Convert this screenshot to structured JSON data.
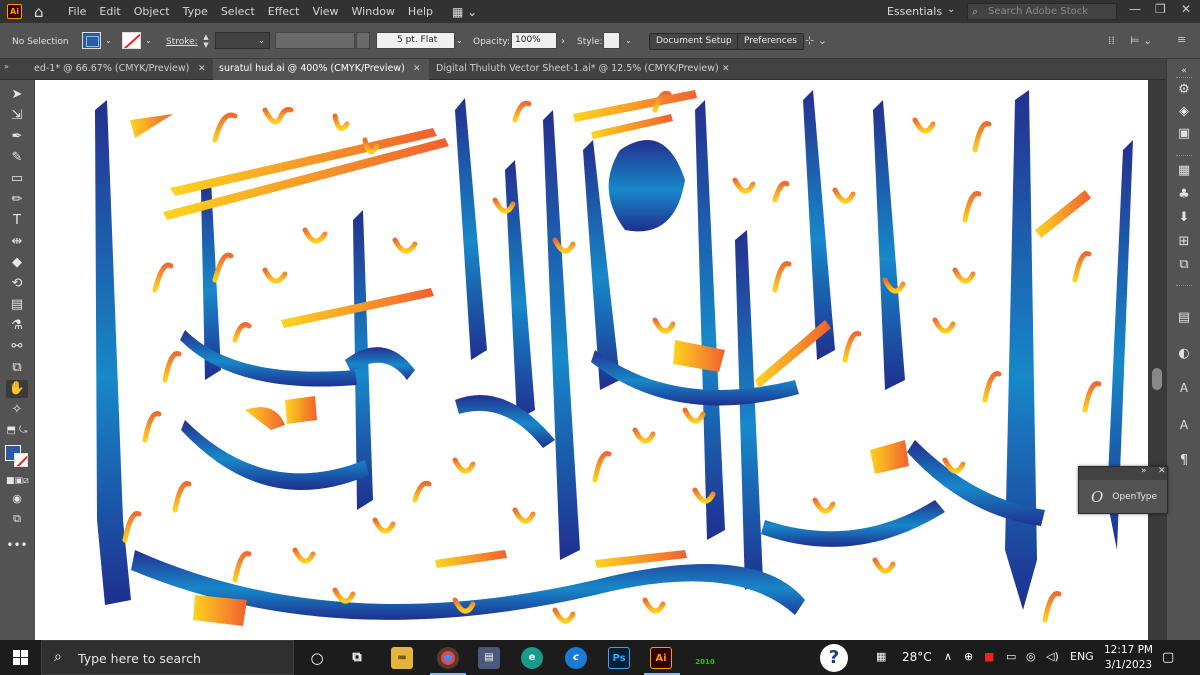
{
  "menubar": {
    "app_icon": "Ai",
    "items": [
      "File",
      "Edit",
      "Object",
      "Type",
      "Select",
      "Effect",
      "View",
      "Window",
      "Help"
    ],
    "workspace": "Essentials",
    "search_placeholder": "Search Adobe Stock"
  },
  "control_bar": {
    "selection": "No Selection",
    "stroke_label": "Stroke:",
    "brush": "5 pt. Flat",
    "opacity_label": "Opacity:",
    "opacity_value": "100%",
    "style_label": "Style:",
    "document_setup": "Document Setup",
    "preferences": "Preferences"
  },
  "tabs": [
    {
      "label": "ed-1* @ 66.67% (CMYK/Preview)",
      "active": false
    },
    {
      "label": "suratul hud.ai @ 400% (CMYK/Preview)",
      "active": true
    },
    {
      "label": "Digital Thuluth Vector Sheet-1.ai* @ 12.5% (CMYK/Preview)",
      "active": false
    }
  ],
  "tools": [
    "selection-tool-icon",
    "direct-selection-tool-icon",
    "pen-tool-icon",
    "curvature-tool-icon",
    "rectangle-tool-icon",
    "pencil-tool-icon",
    "type-tool-icon",
    "reflect-tool-icon",
    "eraser-tool-icon",
    "lasso-tool-icon",
    "gradient-tool-icon",
    "eyedropper-tool-icon",
    "blend-tool-icon",
    "artboard-tool-icon",
    "hand-tool-icon",
    "magic-wand-tool-icon"
  ],
  "colors": {
    "fill": "#2a5aa8",
    "calligraphy_dark": "#1f2f8f",
    "calligraphy_mid": "#1a8fd0",
    "ornament_warm": "#f07030",
    "ornament_yellow": "#ffd21e"
  },
  "opentype_panel": {
    "label": "OpenType"
  },
  "taskbar": {
    "search_placeholder": "Type here to search",
    "temperature": "28°C",
    "language": "ENG",
    "time": "12:17 PM",
    "date": "3/1/2023",
    "year_badge": "2010",
    "ps_label": "Ps",
    "ai_label": "Ai"
  }
}
